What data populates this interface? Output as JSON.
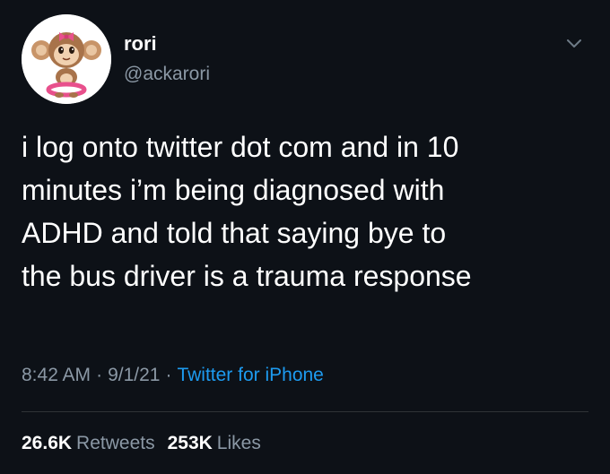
{
  "user": {
    "display_name": "rori",
    "handle": "@ackarori"
  },
  "tweet": {
    "text": "i log onto twitter dot com and in 10\nminutes i’m being diagnosed with\nADHD and told that saying bye to\nthe bus driver is a trauma response",
    "time": "8:42 AM",
    "separator1": "·",
    "date": "9/1/21",
    "separator2": "·",
    "source": "Twitter for iPhone"
  },
  "stats": {
    "retweets_count": "26.6K",
    "retweets_label": "Retweets",
    "likes_count": "253K",
    "likes_label": "Likes"
  },
  "icons": {
    "avatar": "monkey-avatar",
    "menu": "chevron-down-icon"
  },
  "colors": {
    "background": "#0d1117",
    "text": "#ffffff",
    "secondary_text": "#8b98a5",
    "link": "#1d9bf0"
  }
}
